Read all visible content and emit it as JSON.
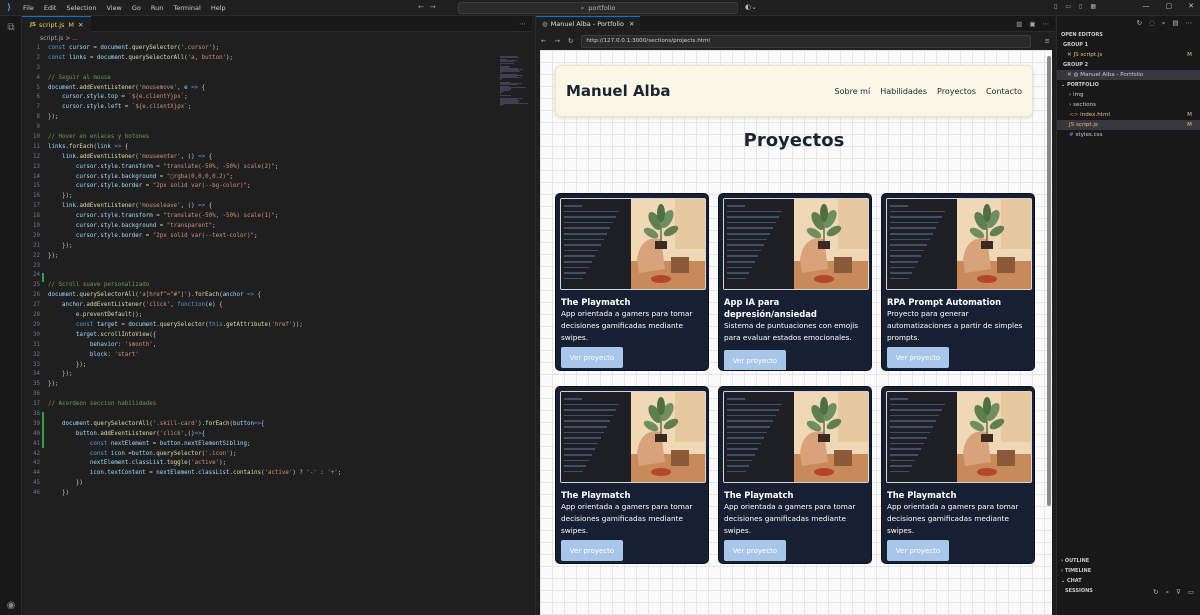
{
  "titlebar": {
    "menu": [
      "File",
      "Edit",
      "Selection",
      "View",
      "Go",
      "Run",
      "Terminal",
      "Help"
    ],
    "search": "portfolio"
  },
  "editor": {
    "tab": {
      "badge": "JS",
      "label": "script.js",
      "modified": "M"
    },
    "breadcrumb": "script.js > ...",
    "lines": [
      {
        "n": "1",
        "html": "<span class='t-kw'>const</span> <span class='t-var'>cursor</span> = <span class='t-var'>document</span>.<span class='t-fn'>querySelector</span>(<span class='t-str'>'.cursor'</span>);"
      },
      {
        "n": "2",
        "html": "<span class='t-kw'>const</span> <span class='t-var'>links</span> = <span class='t-var'>document</span>.<span class='t-fn'>querySelectorAll</span>(<span class='t-str'>'a, button'</span>);"
      },
      {
        "n": "3",
        "html": ""
      },
      {
        "n": "4",
        "html": "<span class='t-cm'>// Seguir al mouse</span>"
      },
      {
        "n": "5",
        "html": "<span class='t-var'>document</span>.<span class='t-fn'>addEventListener</span>(<span class='t-str'>'mousemove'</span>, <span class='t-var'>e</span> <span class='t-kw'>=&gt;</span> {"
      },
      {
        "n": "6",
        "html": "    <span class='t-var'>cursor</span>.<span class='t-var'>style</span>.<span class='t-var'>top</span> = <span class='t-str'>`${e.clientY}px`</span>;"
      },
      {
        "n": "7",
        "html": "    <span class='t-var'>cursor</span>.<span class='t-var'>style</span>.<span class='t-var'>left</span> = <span class='t-str'>`${e.clientX}px`</span>;"
      },
      {
        "n": "8",
        "html": "});"
      },
      {
        "n": "9",
        "html": ""
      },
      {
        "n": "10",
        "html": "<span class='t-cm'>// Hover en enlaces y botones</span>"
      },
      {
        "n": "11",
        "html": "<span class='t-var'>links</span>.<span class='t-fn'>forEach</span>(<span class='t-var'>link</span> <span class='t-kw'>=&gt;</span> {"
      },
      {
        "n": "12",
        "html": "    <span class='t-var'>link</span>.<span class='t-fn'>addEventListener</span>(<span class='t-str'>'mouseenter'</span>, () <span class='t-kw'>=&gt;</span> {"
      },
      {
        "n": "13",
        "html": "        <span class='t-var'>cursor</span>.<span class='t-var'>style</span>.<span class='t-var'>transform</span> = <span class='t-str'>\"translate(-50%, -50%) scale(2)\"</span>;"
      },
      {
        "n": "14",
        "html": "        <span class='t-var'>cursor</span>.<span class='t-var'>style</span>.<span class='t-var'>background</span> = <span class='t-str'>\"▢rgba(0,0,0,0.2)\"</span>;"
      },
      {
        "n": "15",
        "html": "        <span class='t-var'>cursor</span>.<span class='t-var'>style</span>.<span class='t-var'>border</span> = <span class='t-str'>\"2px solid var(--bg-color)\"</span>;"
      },
      {
        "n": "16",
        "html": "    });"
      },
      {
        "n": "17",
        "html": "    <span class='t-var'>link</span>.<span class='t-fn'>addEventListener</span>(<span class='t-str'>'mouseleave'</span>, () <span class='t-kw'>=&gt;</span> {"
      },
      {
        "n": "18",
        "html": "        <span class='t-var'>cursor</span>.<span class='t-var'>style</span>.<span class='t-var'>transform</span> = <span class='t-str'>\"translate(-50%, -50%) scale(1)\"</span>;"
      },
      {
        "n": "19",
        "html": "        <span class='t-var'>cursor</span>.<span class='t-var'>style</span>.<span class='t-var'>background</span> = <span class='t-str'>\"transparent\"</span>;"
      },
      {
        "n": "20",
        "html": "        <span class='t-var'>cursor</span>.<span class='t-var'>style</span>.<span class='t-var'>border</span> = <span class='t-str'>\"2px solid var(--text-color)\"</span>;"
      },
      {
        "n": "21",
        "html": "    });"
      },
      {
        "n": "22",
        "html": "});"
      },
      {
        "n": "23",
        "html": ""
      },
      {
        "n": "24",
        "html": ""
      },
      {
        "n": "25",
        "html": "<span class='t-cm'>// Scroll suave personalizado</span>"
      },
      {
        "n": "26",
        "html": "<span class='t-var'>document</span>.<span class='t-fn'>querySelectorAll</span>(<span class='t-str'>'a[href^=\"#\"]'</span>).<span class='t-fn'>forEach</span>(<span class='t-var'>anchor</span> <span class='t-kw'>=&gt;</span> {"
      },
      {
        "n": "27",
        "html": "    <span class='t-var'>anchor</span>.<span class='t-fn'>addEventListener</span>(<span class='t-str'>'click'</span>, <span class='t-kw'>function</span>(<span class='t-var'>e</span>) {"
      },
      {
        "n": "28",
        "html": "        <span class='t-var'>e</span>.<span class='t-fn'>preventDefault</span>();"
      },
      {
        "n": "29",
        "html": "        <span class='t-kw'>const</span> <span class='t-var'>target</span> = <span class='t-var'>document</span>.<span class='t-fn'>querySelector</span>(<span class='t-kw'>this</span>.<span class='t-fn'>getAttribute</span>(<span class='t-str'>'href'</span>));"
      },
      {
        "n": "30",
        "html": "        <span class='t-var'>target</span>.<span class='t-fn'>scrollIntoView</span>({"
      },
      {
        "n": "31",
        "html": "            <span class='t-var'>behavior</span>: <span class='t-str'>'smooth'</span>,"
      },
      {
        "n": "32",
        "html": "            <span class='t-var'>block</span>: <span class='t-str'>'start'</span>"
      },
      {
        "n": "33",
        "html": "        });"
      },
      {
        "n": "34",
        "html": "    });"
      },
      {
        "n": "35",
        "html": "});"
      },
      {
        "n": "36",
        "html": ""
      },
      {
        "n": "37",
        "html": "<span class='t-cm'>// Acordeon seccion habilidades</span>"
      },
      {
        "n": "38",
        "html": ""
      },
      {
        "n": "39",
        "html": "    <span class='t-var'>document</span>.<span class='t-fn'>querySelectorAll</span>(<span class='t-str'>'.skill-card'</span>).<span class='t-fn'>forEach</span>(<span class='t-var'>button</span><span class='t-kw'>=&gt;</span>{"
      },
      {
        "n": "40",
        "html": "        <span class='t-var'>button</span>.<span class='t-fn'>addEventListener</span>(<span class='t-str'>'click'</span>,()<span class='t-kw'>=&gt;</span>{"
      },
      {
        "n": "41",
        "html": "            <span class='t-kw'>const</span> <span class='t-var'>nextElement</span> = <span class='t-var'>button</span>.<span class='t-var'>nextElementSibling</span>;"
      },
      {
        "n": "42",
        "html": "            <span class='t-kw'>const</span> <span class='t-var'>icon</span> =<span class='t-var'>button</span>.<span class='t-fn'>querySelector</span>(<span class='t-str'>'.icon'</span>);"
      },
      {
        "n": "43",
        "html": "            <span class='t-var'>nextElement</span>.<span class='t-var'>classList</span>.<span class='t-fn'>toggle</span>(<span class='t-str'>'active'</span>);"
      },
      {
        "n": "44",
        "html": "            <span class='t-var'>icon</span>.<span class='t-var'>textContent</span> = <span class='t-var'>nextElement</span>.<span class='t-var'>classList</span>.<span class='t-fn'>contains</span>(<span class='t-str'>'active'</span>) ? <span class='t-str'>'-'</span> : <span class='t-str'>'+'</span>;"
      },
      {
        "n": "45",
        "html": "        })"
      },
      {
        "n": "46",
        "html": "    })"
      }
    ]
  },
  "browser": {
    "tab_title": "Manuel Alba - Portfolio",
    "url": "http://127.0.0.1:3000/sections/projects.html",
    "site": {
      "logo": "Manuel Alba",
      "nav": [
        "Sobre mí",
        "Habilidades",
        "Proyectos",
        "Contacto"
      ],
      "title": "Proyectos",
      "cards": [
        {
          "title": "The Playmatch",
          "desc": "App orientada a gamers para tomar decisiones gamificadas mediante swipes.",
          "button": "Ver proyecto"
        },
        {
          "title": "App IA para depresión/ansiedad",
          "desc": "Sistema de puntuaciones con emojis para evaluar estados emocionales.",
          "button": "Ver proyecto"
        },
        {
          "title": "RPA Prompt Automation",
          "desc": "Proyecto para generar automatizaciones a partir de simples prompts.",
          "button": "Ver proyecto"
        },
        {
          "title": "The Playmatch",
          "desc": "App orientada a gamers para tomar decisiones gamificadas mediante swipes.",
          "button": "Ver proyecto"
        },
        {
          "title": "The Playmatch",
          "desc": "App orientada a gamers para tomar decisiones gamificadas mediante swipes.",
          "button": "Ver proyecto"
        },
        {
          "title": "The Playmatch",
          "desc": "App orientada a gamers para tomar decisiones gamificadas mediante swipes.",
          "button": "Ver proyecto"
        }
      ]
    }
  },
  "explorer": {
    "open_editors": "OPEN EDITORS",
    "group1": "GROUP 1",
    "group1_file": "script.js",
    "group1_badge": "M",
    "group2": "GROUP 2",
    "group2_file": "Manuel Alba - Portfolio",
    "portfolio": "PORTFOLIO",
    "tree": [
      {
        "label": "img",
        "kind": "folder",
        "badge": ""
      },
      {
        "label": "sections",
        "kind": "folder",
        "badge": ""
      },
      {
        "label": "index.html",
        "kind": "html",
        "badge": "M"
      },
      {
        "label": "script.js",
        "kind": "js",
        "badge": "M"
      },
      {
        "label": "styles.css",
        "kind": "css",
        "badge": ""
      }
    ],
    "outline": "OUTLINE",
    "timeline": "TIMELINE",
    "chat": "CHAT",
    "sessions": "SESSIONS"
  }
}
